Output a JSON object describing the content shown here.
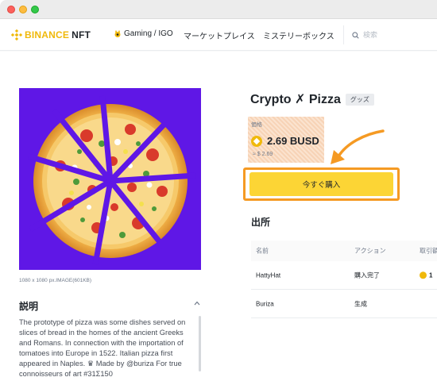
{
  "window": {
    "traffic_lights": [
      "close",
      "minimize",
      "zoom"
    ]
  },
  "navbar": {
    "logo_brand": "BINANCE",
    "logo_product": "NFT",
    "gaming_label": "Gaming / IGO",
    "market_label": "マーケットプレイス",
    "mystery_label": "ミステリーボックス",
    "search_placeholder": "検索"
  },
  "image": {
    "meta": "1080 x 1080 px.IMAGE(601KB)",
    "background_color": "#5f17e6"
  },
  "description": {
    "title": "説明",
    "text": "The prototype of pizza was some dishes served on slices of bread in the homes of the ancient Greeks and Romans. In connection with the importation of tomatoes into Europe in 1522. Italian pizza first appeared in Naples. ♛ Made by @buriza For true connoisseurs of art #31Σ150"
  },
  "product": {
    "title": "Crypto ✗ Pizza",
    "badge": "グッズ",
    "price_label": "価格",
    "price": "2.69 BUSD",
    "price_usd": "≈ $ 2.69",
    "buy_label": "今すぐ購入"
  },
  "provenance": {
    "title": "出所",
    "columns": [
      "名前",
      "アクション",
      "取引額"
    ],
    "rows": [
      {
        "name": "HattyHat",
        "action": "購入完了",
        "amount": "1"
      },
      {
        "name": "Buriza",
        "action": "生成",
        "amount": ""
      }
    ]
  },
  "colors": {
    "brand": "#f0b90b",
    "buy_button": "#fcd535",
    "highlight": "#f59a23"
  }
}
